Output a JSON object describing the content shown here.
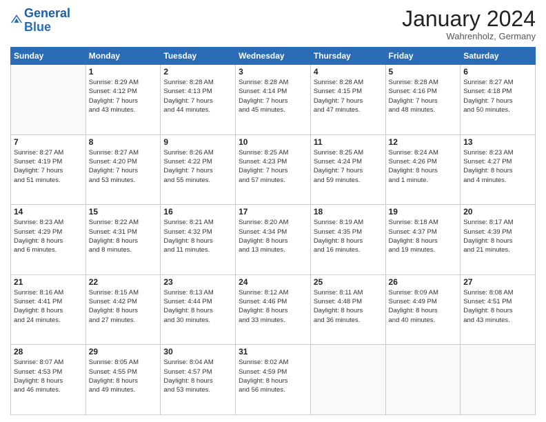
{
  "header": {
    "logo_line1": "General",
    "logo_line2": "Blue",
    "month": "January 2024",
    "location": "Wahrenholz, Germany"
  },
  "days_of_week": [
    "Sunday",
    "Monday",
    "Tuesday",
    "Wednesday",
    "Thursday",
    "Friday",
    "Saturday"
  ],
  "weeks": [
    [
      {
        "day": "",
        "info": ""
      },
      {
        "day": "1",
        "info": "Sunrise: 8:29 AM\nSunset: 4:12 PM\nDaylight: 7 hours\nand 43 minutes."
      },
      {
        "day": "2",
        "info": "Sunrise: 8:28 AM\nSunset: 4:13 PM\nDaylight: 7 hours\nand 44 minutes."
      },
      {
        "day": "3",
        "info": "Sunrise: 8:28 AM\nSunset: 4:14 PM\nDaylight: 7 hours\nand 45 minutes."
      },
      {
        "day": "4",
        "info": "Sunrise: 8:28 AM\nSunset: 4:15 PM\nDaylight: 7 hours\nand 47 minutes."
      },
      {
        "day": "5",
        "info": "Sunrise: 8:28 AM\nSunset: 4:16 PM\nDaylight: 7 hours\nand 48 minutes."
      },
      {
        "day": "6",
        "info": "Sunrise: 8:27 AM\nSunset: 4:18 PM\nDaylight: 7 hours\nand 50 minutes."
      }
    ],
    [
      {
        "day": "7",
        "info": "Sunrise: 8:27 AM\nSunset: 4:19 PM\nDaylight: 7 hours\nand 51 minutes."
      },
      {
        "day": "8",
        "info": "Sunrise: 8:27 AM\nSunset: 4:20 PM\nDaylight: 7 hours\nand 53 minutes."
      },
      {
        "day": "9",
        "info": "Sunrise: 8:26 AM\nSunset: 4:22 PM\nDaylight: 7 hours\nand 55 minutes."
      },
      {
        "day": "10",
        "info": "Sunrise: 8:25 AM\nSunset: 4:23 PM\nDaylight: 7 hours\nand 57 minutes."
      },
      {
        "day": "11",
        "info": "Sunrise: 8:25 AM\nSunset: 4:24 PM\nDaylight: 7 hours\nand 59 minutes."
      },
      {
        "day": "12",
        "info": "Sunrise: 8:24 AM\nSunset: 4:26 PM\nDaylight: 8 hours\nand 1 minute."
      },
      {
        "day": "13",
        "info": "Sunrise: 8:23 AM\nSunset: 4:27 PM\nDaylight: 8 hours\nand 4 minutes."
      }
    ],
    [
      {
        "day": "14",
        "info": "Sunrise: 8:23 AM\nSunset: 4:29 PM\nDaylight: 8 hours\nand 6 minutes."
      },
      {
        "day": "15",
        "info": "Sunrise: 8:22 AM\nSunset: 4:31 PM\nDaylight: 8 hours\nand 8 minutes."
      },
      {
        "day": "16",
        "info": "Sunrise: 8:21 AM\nSunset: 4:32 PM\nDaylight: 8 hours\nand 11 minutes."
      },
      {
        "day": "17",
        "info": "Sunrise: 8:20 AM\nSunset: 4:34 PM\nDaylight: 8 hours\nand 13 minutes."
      },
      {
        "day": "18",
        "info": "Sunrise: 8:19 AM\nSunset: 4:35 PM\nDaylight: 8 hours\nand 16 minutes."
      },
      {
        "day": "19",
        "info": "Sunrise: 8:18 AM\nSunset: 4:37 PM\nDaylight: 8 hours\nand 19 minutes."
      },
      {
        "day": "20",
        "info": "Sunrise: 8:17 AM\nSunset: 4:39 PM\nDaylight: 8 hours\nand 21 minutes."
      }
    ],
    [
      {
        "day": "21",
        "info": "Sunrise: 8:16 AM\nSunset: 4:41 PM\nDaylight: 8 hours\nand 24 minutes."
      },
      {
        "day": "22",
        "info": "Sunrise: 8:15 AM\nSunset: 4:42 PM\nDaylight: 8 hours\nand 27 minutes."
      },
      {
        "day": "23",
        "info": "Sunrise: 8:13 AM\nSunset: 4:44 PM\nDaylight: 8 hours\nand 30 minutes."
      },
      {
        "day": "24",
        "info": "Sunrise: 8:12 AM\nSunset: 4:46 PM\nDaylight: 8 hours\nand 33 minutes."
      },
      {
        "day": "25",
        "info": "Sunrise: 8:11 AM\nSunset: 4:48 PM\nDaylight: 8 hours\nand 36 minutes."
      },
      {
        "day": "26",
        "info": "Sunrise: 8:09 AM\nSunset: 4:49 PM\nDaylight: 8 hours\nand 40 minutes."
      },
      {
        "day": "27",
        "info": "Sunrise: 8:08 AM\nSunset: 4:51 PM\nDaylight: 8 hours\nand 43 minutes."
      }
    ],
    [
      {
        "day": "28",
        "info": "Sunrise: 8:07 AM\nSunset: 4:53 PM\nDaylight: 8 hours\nand 46 minutes."
      },
      {
        "day": "29",
        "info": "Sunrise: 8:05 AM\nSunset: 4:55 PM\nDaylight: 8 hours\nand 49 minutes."
      },
      {
        "day": "30",
        "info": "Sunrise: 8:04 AM\nSunset: 4:57 PM\nDaylight: 8 hours\nand 53 minutes."
      },
      {
        "day": "31",
        "info": "Sunrise: 8:02 AM\nSunset: 4:59 PM\nDaylight: 8 hours\nand 56 minutes."
      },
      {
        "day": "",
        "info": ""
      },
      {
        "day": "",
        "info": ""
      },
      {
        "day": "",
        "info": ""
      }
    ]
  ]
}
